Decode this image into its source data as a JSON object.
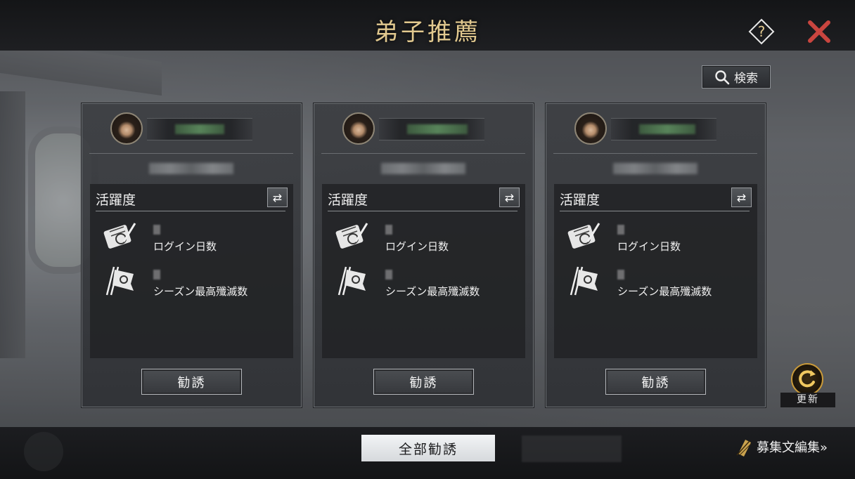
{
  "header": {
    "title": "弟子推薦"
  },
  "toolbar": {
    "search_label": "検索"
  },
  "cards": [
    {
      "stats_title": "活躍度",
      "stat_login_label": "ログイン日数",
      "stat_kills_label": "シーズン最高殲滅数",
      "recruit_label": "勧誘"
    },
    {
      "stats_title": "活躍度",
      "stat_login_label": "ログイン日数",
      "stat_kills_label": "シーズン最高殲滅数",
      "recruit_label": "勧誘"
    },
    {
      "stats_title": "活躍度",
      "stat_login_label": "ログイン日数",
      "stat_kills_label": "シーズン最高殲滅数",
      "recruit_label": "勧誘"
    }
  ],
  "side": {
    "refresh_label": "更新"
  },
  "footer": {
    "recruit_all_label": "全部勧誘",
    "edit_label": "募集文編集»"
  },
  "colors": {
    "title_gold": "#e2c98f",
    "close_red": "#c9453f",
    "refresh_ring": "#c99a3a"
  }
}
